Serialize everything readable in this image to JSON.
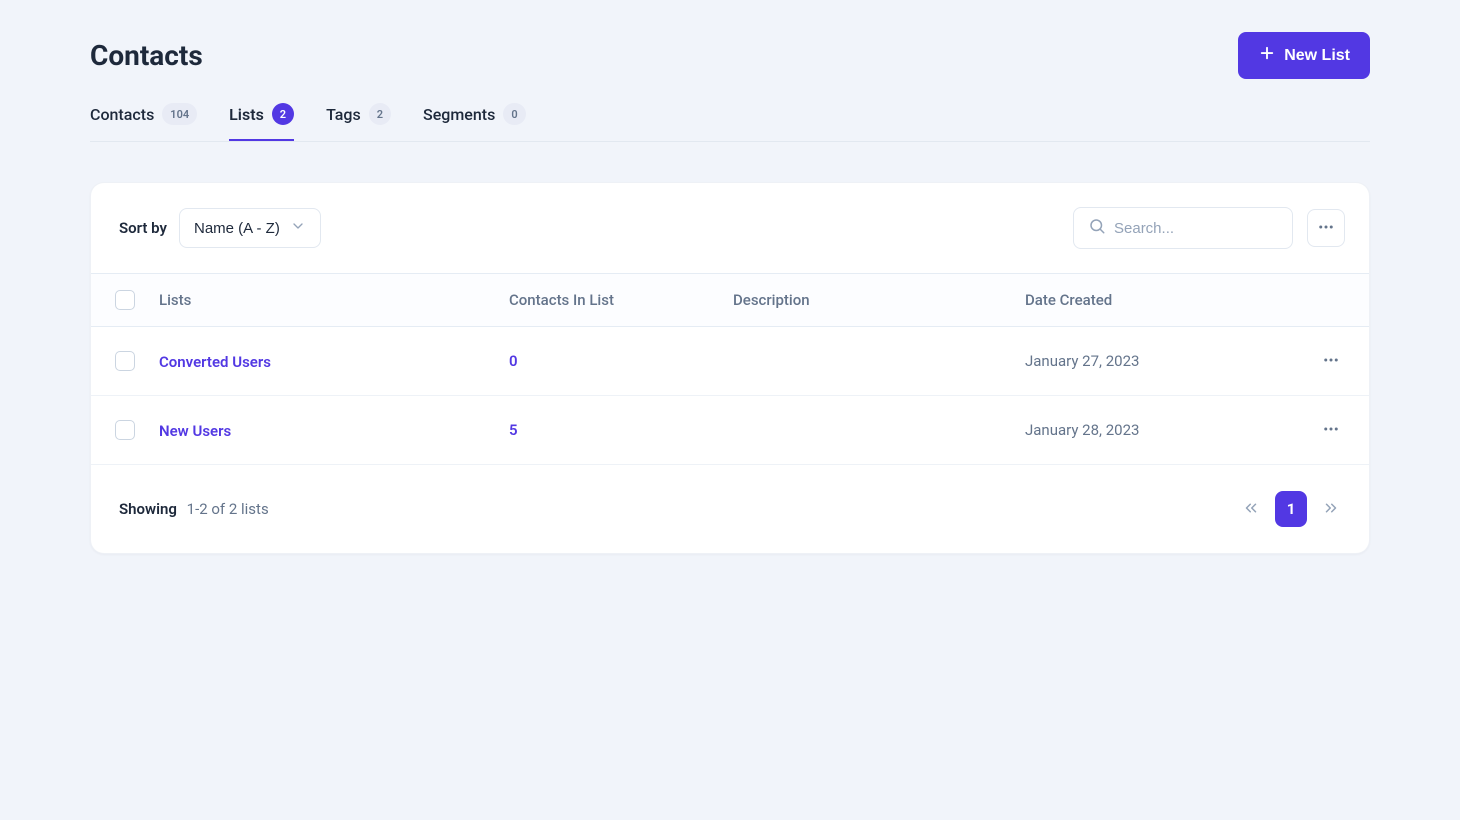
{
  "header": {
    "title": "Contacts",
    "new_list_label": "New List"
  },
  "tabs": [
    {
      "label": "Contacts",
      "count": "104"
    },
    {
      "label": "Lists",
      "count": "2"
    },
    {
      "label": "Tags",
      "count": "2"
    },
    {
      "label": "Segments",
      "count": "0"
    }
  ],
  "toolbar": {
    "sort_by_label": "Sort by",
    "sort_value": "Name (A - Z)",
    "search_placeholder": "Search..."
  },
  "table": {
    "columns": {
      "lists": "Lists",
      "contacts": "Contacts In List",
      "description": "Description",
      "date": "Date Created"
    },
    "rows": [
      {
        "name": "Converted Users",
        "contacts": "0",
        "description": "",
        "date": "January 27, 2023"
      },
      {
        "name": "New Users",
        "contacts": "5",
        "description": "",
        "date": "January 28, 2023"
      }
    ]
  },
  "footer": {
    "showing_label": "Showing",
    "showing_value": "1-2 of 2 lists",
    "current_page": "1"
  }
}
